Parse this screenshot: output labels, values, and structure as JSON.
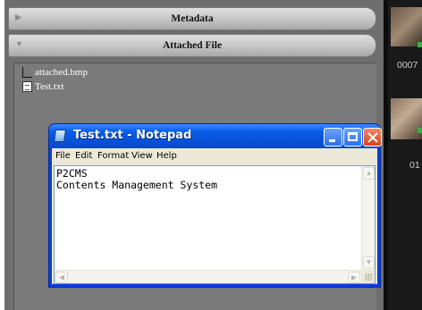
{
  "cms": {
    "sections": [
      {
        "label": "Metadata",
        "expanded": false
      },
      {
        "label": "Attached File",
        "expanded": true
      }
    ],
    "files": [
      {
        "name": "attached.bmp",
        "icon": "bitmap-file-icon"
      },
      {
        "name": "Test.txt",
        "icon": "text-file-icon"
      }
    ]
  },
  "sidebar": {
    "thumb_numbers": [
      "0007",
      "01"
    ]
  },
  "notepad": {
    "title": "Test.txt - Notepad",
    "menu": [
      "File",
      "Edit",
      "Format",
      "View",
      "Help"
    ],
    "lines": [
      "P2CMS",
      "Contents Management System"
    ]
  }
}
